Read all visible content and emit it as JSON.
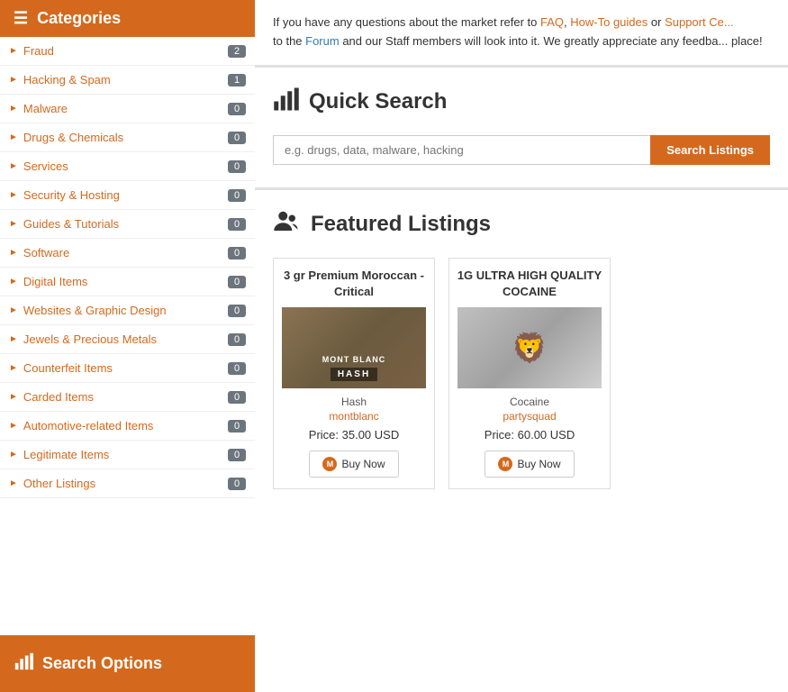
{
  "sidebar": {
    "header_label": "Categories",
    "header_icon": "☰",
    "categories": [
      {
        "id": "fraud",
        "label": "Fraud",
        "count": "2"
      },
      {
        "id": "hacking-spam",
        "label": "Hacking & Spam",
        "count": "1"
      },
      {
        "id": "malware",
        "label": "Malware",
        "count": "0"
      },
      {
        "id": "drugs-chemicals",
        "label": "Drugs & Chemicals",
        "count": "0"
      },
      {
        "id": "services",
        "label": "Services",
        "count": "0"
      },
      {
        "id": "security-hosting",
        "label": "Security & Hosting",
        "count": "0"
      },
      {
        "id": "guides-tutorials",
        "label": "Guides & Tutorials",
        "count": "0"
      },
      {
        "id": "software",
        "label": "Software",
        "count": "0"
      },
      {
        "id": "digital-items",
        "label": "Digital Items",
        "count": "0"
      },
      {
        "id": "websites-graphic-design",
        "label": "Websites & Graphic Design",
        "count": "0"
      },
      {
        "id": "jewels-precious-metals",
        "label": "Jewels & Precious Metals",
        "count": "0"
      },
      {
        "id": "counterfeit-items",
        "label": "Counterfeit Items",
        "count": "0"
      },
      {
        "id": "carded-items",
        "label": "Carded Items",
        "count": "0"
      },
      {
        "id": "automotive-related",
        "label": "Automotive-related Items",
        "count": "0"
      },
      {
        "id": "legitimate-items",
        "label": "Legitimate Items",
        "count": "0"
      },
      {
        "id": "other-listings",
        "label": "Other Listings",
        "count": "0"
      }
    ],
    "footer_label": "Search Options",
    "footer_icon": "📊"
  },
  "info_banner": {
    "text_before": "If you have any questions about the market refer to",
    "link_faq": "FAQ",
    "text_middle1": ",",
    "link_howto": "How-To guides",
    "text_or": "or",
    "link_support": "Support Ce...",
    "text_forum_pre": "to the",
    "link_forum": "Forum",
    "text_after": "and our Staff members will look into it. We greatly appreciate any feedba... place!"
  },
  "quick_search": {
    "title": "Quick Search",
    "icon": "📊",
    "placeholder": "e.g. drugs, data, malware, hacking",
    "button_label": "Search Listings"
  },
  "featured": {
    "title": "Featured Listings",
    "icon": "👥",
    "listings": [
      {
        "id": "listing-1",
        "title": "3 gr Premium Moroccan - Critical",
        "image_type": "hash",
        "image_label": "HASH",
        "brand": "MONT BLANC",
        "category": "Hash",
        "seller": "montblanc",
        "price": "Price: 35.00 USD",
        "buy_label": "Buy Now"
      },
      {
        "id": "listing-2",
        "title": "1G ULTRA HIGH QUALITY COCAINE",
        "image_type": "cocaine",
        "image_label": "",
        "brand": "",
        "category": "Cocaine",
        "seller": "partysquad",
        "price": "Price: 60.00 USD",
        "buy_label": "Buy Now"
      }
    ]
  },
  "colors": {
    "orange": "#d4691e",
    "badge_gray": "#6c757d"
  }
}
